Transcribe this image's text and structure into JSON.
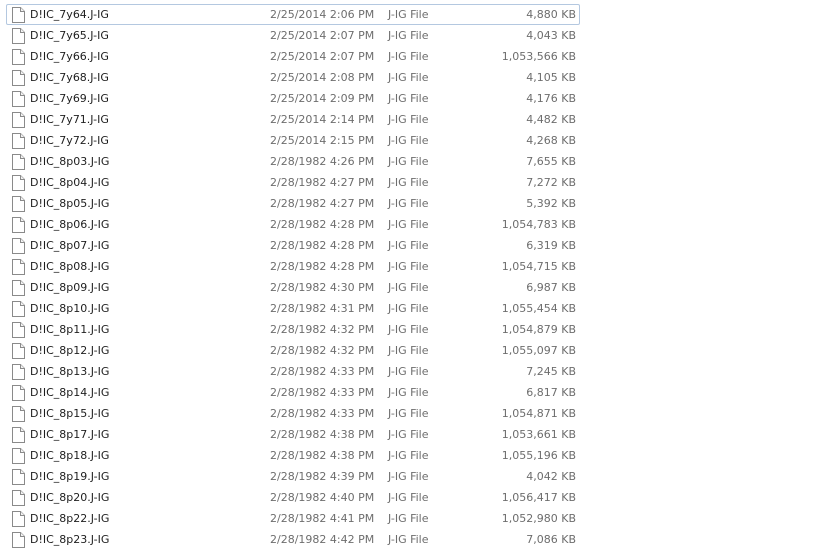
{
  "files": [
    {
      "name": "D!IC_7y64.J-IG",
      "date": "2/25/2014 2:06 PM",
      "type": "J-IG File",
      "size": "4,880 KB",
      "icon": "file-icon"
    },
    {
      "name": "D!IC_7y65.J-IG",
      "date": "2/25/2014 2:07 PM",
      "type": "J-IG File",
      "size": "4,043 KB",
      "icon": "file-icon"
    },
    {
      "name": "D!IC_7y66.J-IG",
      "date": "2/25/2014 2:07 PM",
      "type": "J-IG File",
      "size": "1,053,566 KB",
      "icon": "file-icon"
    },
    {
      "name": "D!IC_7y68.J-IG",
      "date": "2/25/2014 2:08 PM",
      "type": "J-IG File",
      "size": "4,105 KB",
      "icon": "file-icon"
    },
    {
      "name": "D!IC_7y69.J-IG",
      "date": "2/25/2014 2:09 PM",
      "type": "J-IG File",
      "size": "4,176 KB",
      "icon": "file-icon"
    },
    {
      "name": "D!IC_7y71.J-IG",
      "date": "2/25/2014 2:14 PM",
      "type": "J-IG File",
      "size": "4,482 KB",
      "icon": "file-icon"
    },
    {
      "name": "D!IC_7y72.J-IG",
      "date": "2/25/2014 2:15 PM",
      "type": "J-IG File",
      "size": "4,268 KB",
      "icon": "file-icon"
    },
    {
      "name": "D!IC_8p03.J-IG",
      "date": "2/28/1982 4:26 PM",
      "type": "J-IG File",
      "size": "7,655 KB",
      "icon": "file-icon"
    },
    {
      "name": "D!IC_8p04.J-IG",
      "date": "2/28/1982 4:27 PM",
      "type": "J-IG File",
      "size": "7,272 KB",
      "icon": "file-icon"
    },
    {
      "name": "D!IC_8p05.J-IG",
      "date": "2/28/1982 4:27 PM",
      "type": "J-IG File",
      "size": "5,392 KB",
      "icon": "file-icon"
    },
    {
      "name": "D!IC_8p06.J-IG",
      "date": "2/28/1982 4:28 PM",
      "type": "J-IG File",
      "size": "1,054,783 KB",
      "icon": "file-icon"
    },
    {
      "name": "D!IC_8p07.J-IG",
      "date": "2/28/1982 4:28 PM",
      "type": "J-IG File",
      "size": "6,319 KB",
      "icon": "file-icon"
    },
    {
      "name": "D!IC_8p08.J-IG",
      "date": "2/28/1982 4:28 PM",
      "type": "J-IG File",
      "size": "1,054,715 KB",
      "icon": "file-icon"
    },
    {
      "name": "D!IC_8p09.J-IG",
      "date": "2/28/1982 4:30 PM",
      "type": "J-IG File",
      "size": "6,987 KB",
      "icon": "file-icon"
    },
    {
      "name": "D!IC_8p10.J-IG",
      "date": "2/28/1982 4:31 PM",
      "type": "J-IG File",
      "size": "1,055,454 KB",
      "icon": "file-icon"
    },
    {
      "name": "D!IC_8p11.J-IG",
      "date": "2/28/1982 4:32 PM",
      "type": "J-IG File",
      "size": "1,054,879 KB",
      "icon": "file-icon"
    },
    {
      "name": "D!IC_8p12.J-IG",
      "date": "2/28/1982 4:32 PM",
      "type": "J-IG File",
      "size": "1,055,097 KB",
      "icon": "file-icon"
    },
    {
      "name": "D!IC_8p13.J-IG",
      "date": "2/28/1982 4:33 PM",
      "type": "J-IG File",
      "size": "7,245 KB",
      "icon": "file-icon"
    },
    {
      "name": "D!IC_8p14.J-IG",
      "date": "2/28/1982 4:33 PM",
      "type": "J-IG File",
      "size": "6,817 KB",
      "icon": "file-icon"
    },
    {
      "name": "D!IC_8p15.J-IG",
      "date": "2/28/1982 4:33 PM",
      "type": "J-IG File",
      "size": "1,054,871 KB",
      "icon": "file-icon"
    },
    {
      "name": "D!IC_8p17.J-IG",
      "date": "2/28/1982 4:38 PM",
      "type": "J-IG File",
      "size": "1,053,661 KB",
      "icon": "file-icon"
    },
    {
      "name": "D!IC_8p18.J-IG",
      "date": "2/28/1982 4:38 PM",
      "type": "J-IG File",
      "size": "1,055,196 KB",
      "icon": "file-icon"
    },
    {
      "name": "D!IC_8p19.J-IG",
      "date": "2/28/1982 4:39 PM",
      "type": "J-IG File",
      "size": "4,042 KB",
      "icon": "file-icon"
    },
    {
      "name": "D!IC_8p20.J-IG",
      "date": "2/28/1982 4:40 PM",
      "type": "J-IG File",
      "size": "1,056,417 KB",
      "icon": "file-icon"
    },
    {
      "name": "D!IC_8p22.J-IG",
      "date": "2/28/1982 4:41 PM",
      "type": "J-IG File",
      "size": "1,052,980 KB",
      "icon": "file-icon"
    },
    {
      "name": "D!IC_8p23.J-IG",
      "date": "2/28/1982 4:42 PM",
      "type": "J-IG File",
      "size": "7,086 KB",
      "icon": "file-icon"
    }
  ],
  "focused_index": 0,
  "colors": {
    "focus_border": "#b4c8e0",
    "name_text": "#1e1e1e",
    "detail_text": "#6d6d6d",
    "icon_stroke": "#8a8a8a"
  }
}
